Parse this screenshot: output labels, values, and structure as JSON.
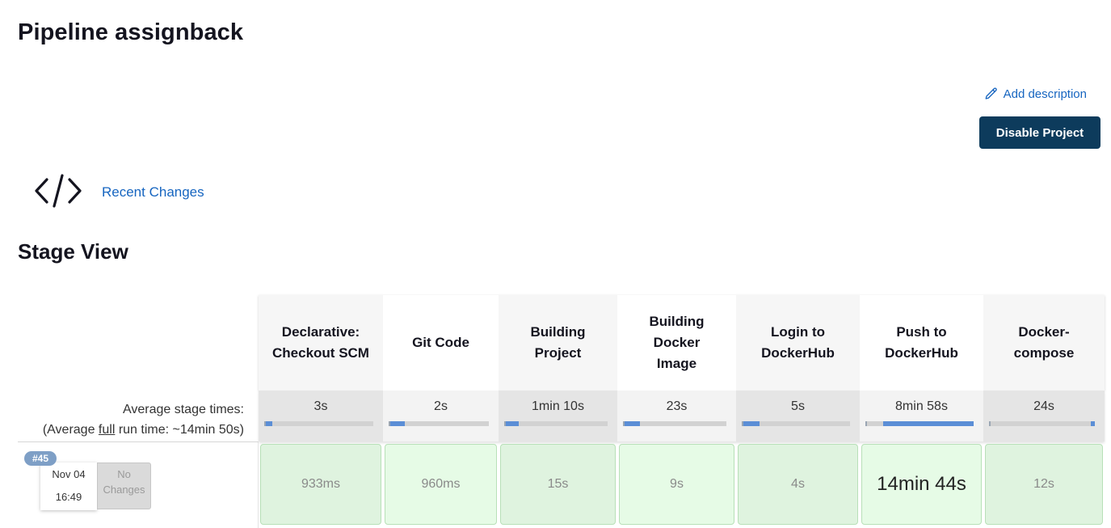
{
  "page": {
    "title": "Pipeline assignback",
    "add_description": "Add description",
    "disable_button": "Disable Project",
    "recent_changes": "Recent Changes",
    "stage_view_title": "Stage View"
  },
  "stage_view": {
    "avg_label_line1": "Average stage times:",
    "avg_label_pre": "(Average ",
    "avg_label_link": "full",
    "avg_label_post": " run time: ~14min 50s)",
    "stages": [
      {
        "name": "Declarative: Checkout SCM",
        "avg": "3s",
        "avg_fraction": 0.06
      },
      {
        "name": "Git Code",
        "avg": "2s",
        "avg_fraction": 0.15
      },
      {
        "name": "Building Project",
        "avg": "1min 10s",
        "avg_fraction": 0.13
      },
      {
        "name": "Building Docker Image",
        "avg": "23s",
        "avg_fraction": 0.15
      },
      {
        "name": "Login to DockerHub",
        "avg": "5s",
        "avg_fraction": 0.15
      },
      {
        "name": "Push to DockerHub",
        "avg": "8min 58s",
        "avg_fraction": 0.85
      },
      {
        "name": "Docker-compose",
        "avg": "24s",
        "avg_fraction": 0.04
      }
    ],
    "builds": [
      {
        "number": "#45",
        "date": "Nov 04",
        "time": "16:49",
        "changes": "No Changes",
        "durations": [
          "933ms",
          "960ms",
          "15s",
          "9s",
          "4s",
          "14min 44s",
          "12s"
        ]
      }
    ]
  },
  "colors": {
    "primary_button": "#0d3b5c",
    "link": "#1665c0",
    "success_cell": "#dff3df",
    "build_badge": "#7e9fc6"
  },
  "icons": {
    "edit": "pencil-icon",
    "code": "code-brackets-icon"
  }
}
